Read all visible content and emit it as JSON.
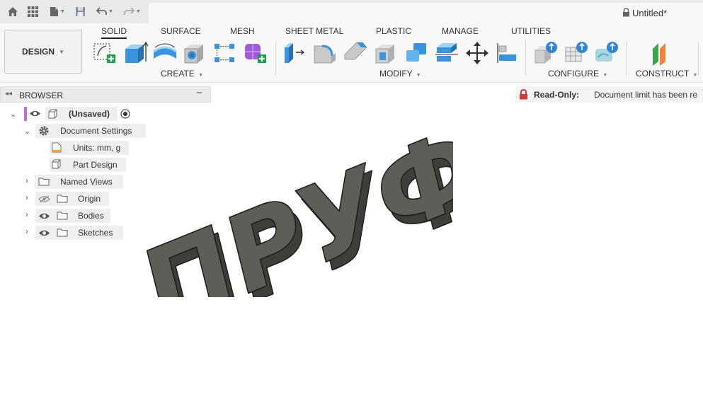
{
  "window": {
    "document_title": "Untitled*"
  },
  "workspace": {
    "label": "DESIGN"
  },
  "ribbon": {
    "tabs": [
      "SOLID",
      "SURFACE",
      "MESH",
      "SHEET METAL",
      "PLASTIC",
      "MANAGE",
      "UTILITIES"
    ],
    "active_tab": "SOLID",
    "groups": {
      "create": "CREATE",
      "modify": "MODIFY",
      "configure": "CONFIGURE",
      "construct": "CONSTRUCT"
    }
  },
  "browser": {
    "title": "BROWSER",
    "root": "(Unsaved)",
    "items": {
      "document_settings": "Document Settings",
      "units": "Units: mm, g",
      "part_design": "Part Design",
      "named_views": "Named Views",
      "origin": "Origin",
      "bodies": "Bodies",
      "sketches": "Sketches"
    }
  },
  "notice": {
    "label": "Read-Only:",
    "message": "Document limit has been re"
  },
  "model": {
    "text": "ПРУФЫ"
  },
  "colors": {
    "accent": "#d23a3a",
    "body": "#5e5d58",
    "selection": "#c66bd1"
  }
}
